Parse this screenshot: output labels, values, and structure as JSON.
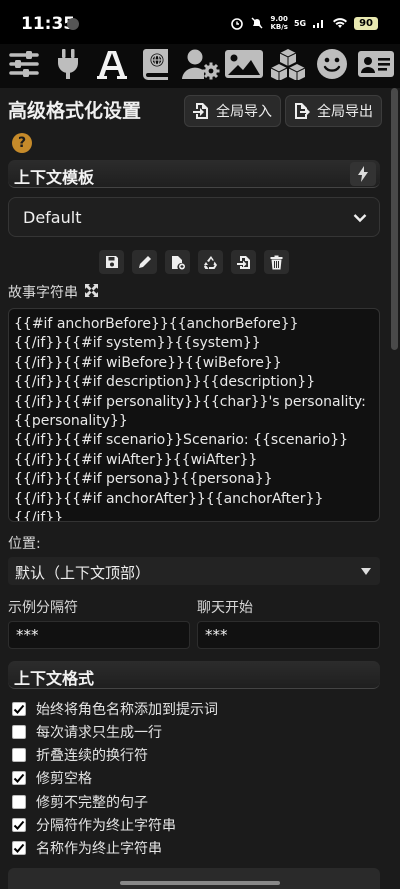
{
  "status": {
    "time": "11:35",
    "net_speed_value": "9.00",
    "net_speed_unit": "KB/s",
    "network": "5G",
    "battery": "90"
  },
  "nav": {
    "icons": [
      "sliders-icon",
      "plug-icon",
      "font-icon",
      "book-globe-icon",
      "user-gear-icon",
      "image-icon",
      "cubes-icon",
      "smiley-icon",
      "id-card-icon"
    ]
  },
  "header": {
    "title": "高级格式化设置",
    "import_label": "全局导入",
    "export_label": "全局导出"
  },
  "context_template": {
    "title": "上下文模板",
    "selected": "Default",
    "story_label": "故事字符串",
    "story_string": "{{#if anchorBefore}}{{anchorBefore}}\n{{/if}}{{#if system}}{{system}}\n{{/if}}{{#if wiBefore}}{{wiBefore}}\n{{/if}}{{#if description}}{{description}}\n{{/if}}{{#if personality}}{{char}}'s personality:\n{{personality}}\n{{/if}}{{#if scenario}}Scenario: {{scenario}}\n{{/if}}{{#if wiAfter}}{{wiAfter}}\n{{/if}}{{#if persona}}{{persona}}\n{{/if}}{{#if anchorAfter}}{{anchorAfter}}\n{{/if}}",
    "position_label": "位置:",
    "position_value": "默认（上下文顶部）",
    "example_sep_label": "示例分隔符",
    "example_sep_value": "***",
    "chat_start_label": "聊天开始",
    "chat_start_value": "***"
  },
  "context_format": {
    "title": "上下文格式",
    "options": [
      {
        "label": "始终将角色名称添加到提示词",
        "checked": true
      },
      {
        "label": "每次请求只生成一行",
        "checked": false
      },
      {
        "label": "折叠连续的换行符",
        "checked": false
      },
      {
        "label": "修剪空格",
        "checked": true
      },
      {
        "label": "修剪不完整的句子",
        "checked": false
      },
      {
        "label": "分隔符作为终止字符串",
        "checked": true
      },
      {
        "label": "名称作为终止字符串",
        "checked": true
      }
    ]
  },
  "colors": {
    "accent": "#c58a2a",
    "panel": "#1b1b1b",
    "nav_icon": "#bdbdbd"
  }
}
